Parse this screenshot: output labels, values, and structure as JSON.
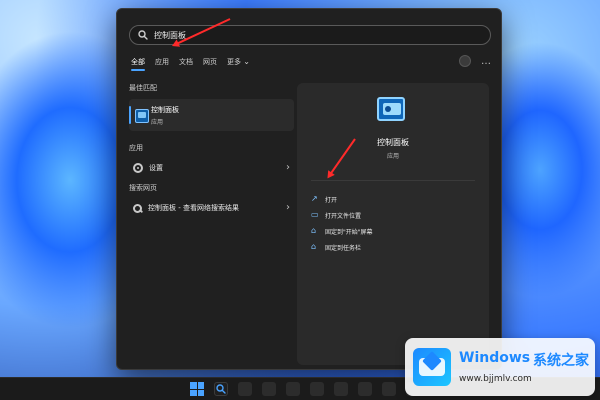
{
  "search": {
    "value": "控制面板"
  },
  "tabs": [
    {
      "label": "全部"
    },
    {
      "label": "应用"
    },
    {
      "label": "文档"
    },
    {
      "label": "网页"
    },
    {
      "label": "更多"
    }
  ],
  "left": {
    "best_match_title": "最佳匹配",
    "best_match": {
      "name": "控制面板",
      "type": "应用"
    },
    "apps_title": "应用",
    "apps_item": "设置",
    "web_title": "搜索网页",
    "web_item": "控制面板 - 查看网络搜索结果"
  },
  "right": {
    "title": "控制面板",
    "subtitle": "应用",
    "actions": [
      {
        "label": "打开"
      },
      {
        "label": "打开文件位置"
      },
      {
        "label": "固定到\"开始\"屏幕"
      },
      {
        "label": "固定到任务栏"
      }
    ]
  },
  "watermark": {
    "title": "Windows",
    "title2": "系统之家",
    "url": "www.bjjmlv.com"
  },
  "colors": {
    "accent": "#4aa3ff",
    "arrow": "#ff2a2a"
  },
  "icons": {
    "search": "search-icon",
    "gear": "gear-icon",
    "chevron": "chevron-right-icon",
    "more": "ellipsis-icon",
    "avatar": "avatar-icon"
  }
}
